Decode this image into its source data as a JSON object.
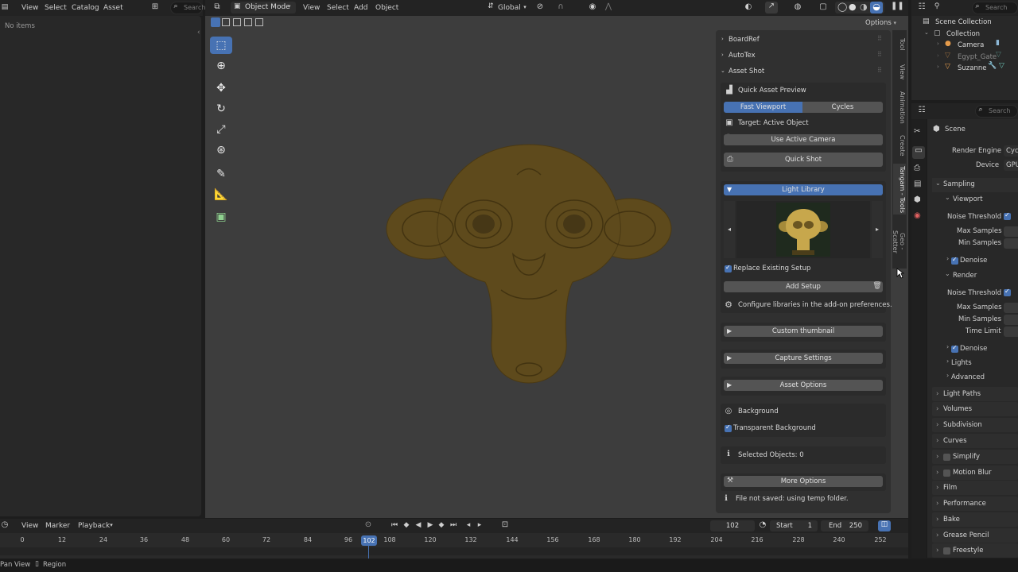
{
  "asset_browser": {
    "menu": [
      "View",
      "Select",
      "Catalog",
      "Asset"
    ],
    "search_placeholder": "Search",
    "empty_text": "No items"
  },
  "viewport_header": {
    "mode": "Object Mode",
    "menu": [
      "View",
      "Select",
      "Add",
      "Object"
    ],
    "orientation": "Global",
    "options_label": "Options"
  },
  "side_tabs": [
    "Tool",
    "View",
    "Animation",
    "Create",
    "Tangam - Tools",
    "Geo - Scatter"
  ],
  "npanel": {
    "collapsed_panels": [
      "BoardRef",
      "AutoTex"
    ],
    "asset_shot_title": "Asset Shot",
    "quick_preview_title": "Quick Asset Preview",
    "engine_options": [
      "Fast Viewport",
      "Cycles"
    ],
    "target_label": "Target: Active Object",
    "use_camera_label": "Use Active Camera",
    "quick_shot_label": "Quick Shot",
    "light_library_label": "Light Library",
    "replace_setup_label": "Replace Existing Setup",
    "add_setup_label": "Add Setup",
    "configure_text": "Configure libraries in the add-on preferences.",
    "custom_thumbnail_label": "Custom thumbnail",
    "capture_settings_label": "Capture Settings",
    "asset_options_label": "Asset Options",
    "background_label": "Background",
    "transparent_bg_label": "Transparent Background",
    "selected_objects_label": "Selected Objects: 0",
    "more_options_label": "More Options",
    "file_status": "File not saved: using temp folder."
  },
  "outliner": {
    "search_placeholder": "Search",
    "items": [
      "Scene Collection",
      "Collection",
      "Camera",
      "Egypt_Gate",
      "Suzanne"
    ]
  },
  "properties": {
    "search_placeholder": "Search",
    "scene_label": "Scene",
    "render_engine_label": "Render Engine",
    "render_engine_value": "Cyc",
    "device_label": "Device",
    "device_value": "GPU",
    "sampling": "Sampling",
    "viewport": "Viewport",
    "noise_threshold": "Noise Threshold",
    "max_samples": "Max Samples",
    "min_samples": "Min Samples",
    "denoise": "Denoise",
    "render": "Render",
    "time_limit": "Time Limit",
    "lights": "Lights",
    "advanced": "Advanced",
    "sections": [
      "Light Paths",
      "Volumes",
      "Subdivision",
      "Curves",
      "Simplify",
      "Motion Blur",
      "Film",
      "Performance",
      "Bake",
      "Grease Pencil",
      "Freestyle"
    ]
  },
  "timeline": {
    "menu": [
      "View",
      "Marker",
      "Playback"
    ],
    "current_frame": "102",
    "start_label": "Start",
    "start_value": "1",
    "end_label": "End",
    "end_value": "250",
    "ticks": [
      "0",
      "12",
      "24",
      "36",
      "48",
      "60",
      "72",
      "84",
      "96",
      "102",
      "108",
      "120",
      "132",
      "144",
      "156",
      "168",
      "180",
      "192",
      "204",
      "216",
      "228",
      "240",
      "252"
    ]
  },
  "status_bar": {
    "left": "Pan View",
    "right": "Region"
  },
  "colors": {
    "accent_blue": "#4772b3",
    "viewport_bg": "#3d3d3d",
    "monkey": "#5e4a1c",
    "panel_bg": "#2b2b2b"
  }
}
